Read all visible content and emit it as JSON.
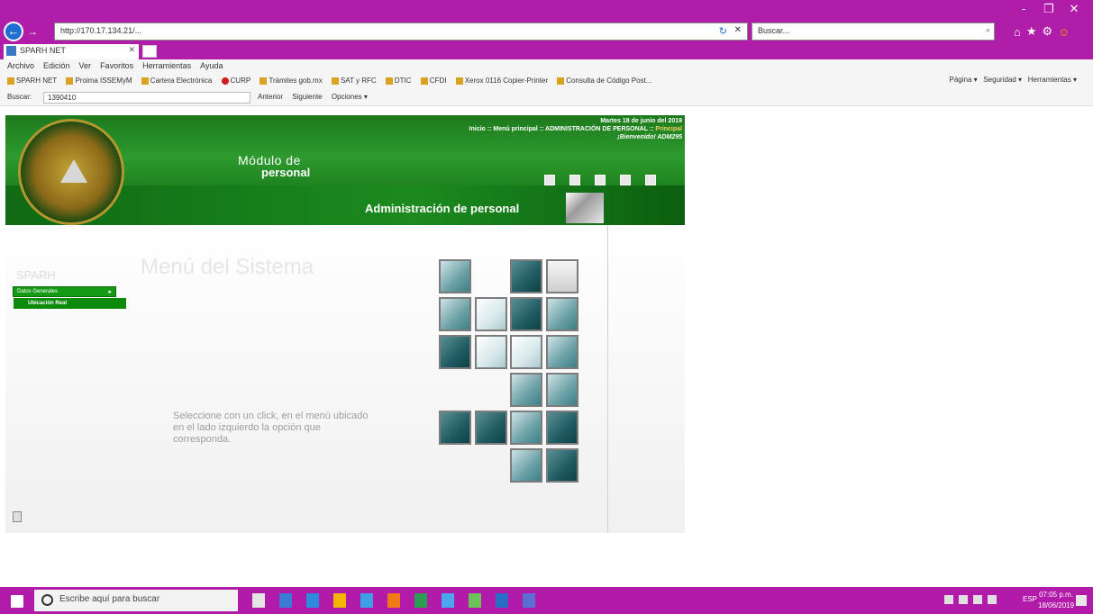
{
  "browser": {
    "address": "http://170.17.134.21/...",
    "search_placeholder": "Buscar...",
    "tab_title": "SPARH NET",
    "window_controls": [
      "-",
      "❐",
      "✕"
    ]
  },
  "menu": [
    "Archivo",
    "Edición",
    "Ver",
    "Favoritos",
    "Herramientas",
    "Ayuda"
  ],
  "favorites": [
    {
      "label": "SPARH NET",
      "icon": "folder-icon"
    },
    {
      "label": "Proima ISSEMyM",
      "icon": "folder-icon"
    },
    {
      "label": "Cartera Electrónica",
      "icon": "folder-icon"
    },
    {
      "label": "CURP",
      "icon": "record-icon"
    },
    {
      "label": "Trámites gob.mx",
      "icon": "folder-icon"
    },
    {
      "label": "SAT y RFC",
      "icon": "folder-icon"
    },
    {
      "label": "DTIC",
      "icon": "folder-icon"
    },
    {
      "label": "CFDI",
      "icon": "folder-icon"
    },
    {
      "label": "Xerox 0116 Copier-Printer",
      "icon": "folder-icon"
    },
    {
      "label": "Consulta de Código Post...",
      "icon": "folder-icon"
    }
  ],
  "commandbar": {
    "pagina": "Página ▾",
    "seguridad": "Seguridad ▾",
    "herramientas": "Herramientas ▾"
  },
  "findbar": {
    "label": "Buscar:",
    "value": "1390410",
    "anterior": "Anterior",
    "siguiente": "Siguiente",
    "opciones": "Opciones ▾"
  },
  "site": {
    "modulo_line1": "Módulo de",
    "modulo_line2": "personal",
    "date": "Martes 18 de junio del 2019",
    "breadcrumb_main": "Inicio :: Menú principal :: ADMINISTRACIÓN DE PERSONAL :: ",
    "breadcrumb_current": "Principal",
    "welcome": "¡Bienvenido! ADM295",
    "section_title": "Administración de personal",
    "side_faded": "SPARH",
    "faded_title": "Menú del Sistema",
    "menu_item_1": "Datos Generales",
    "menu_item_2": "Ubicación Real",
    "instructions": "Seleccione con un click, en el menú ubicado en el lado izquierdo la opción que corresponda."
  },
  "taskbar": {
    "search_placeholder": "Escribe aquí para buscar",
    "lang": "ESP",
    "time": "07:05 p.m.",
    "date": "18/06/2019"
  },
  "colors": {
    "window_chrome": "#b01da9",
    "banner_green": "#1c7a1c",
    "menu_green": "#159a15"
  }
}
